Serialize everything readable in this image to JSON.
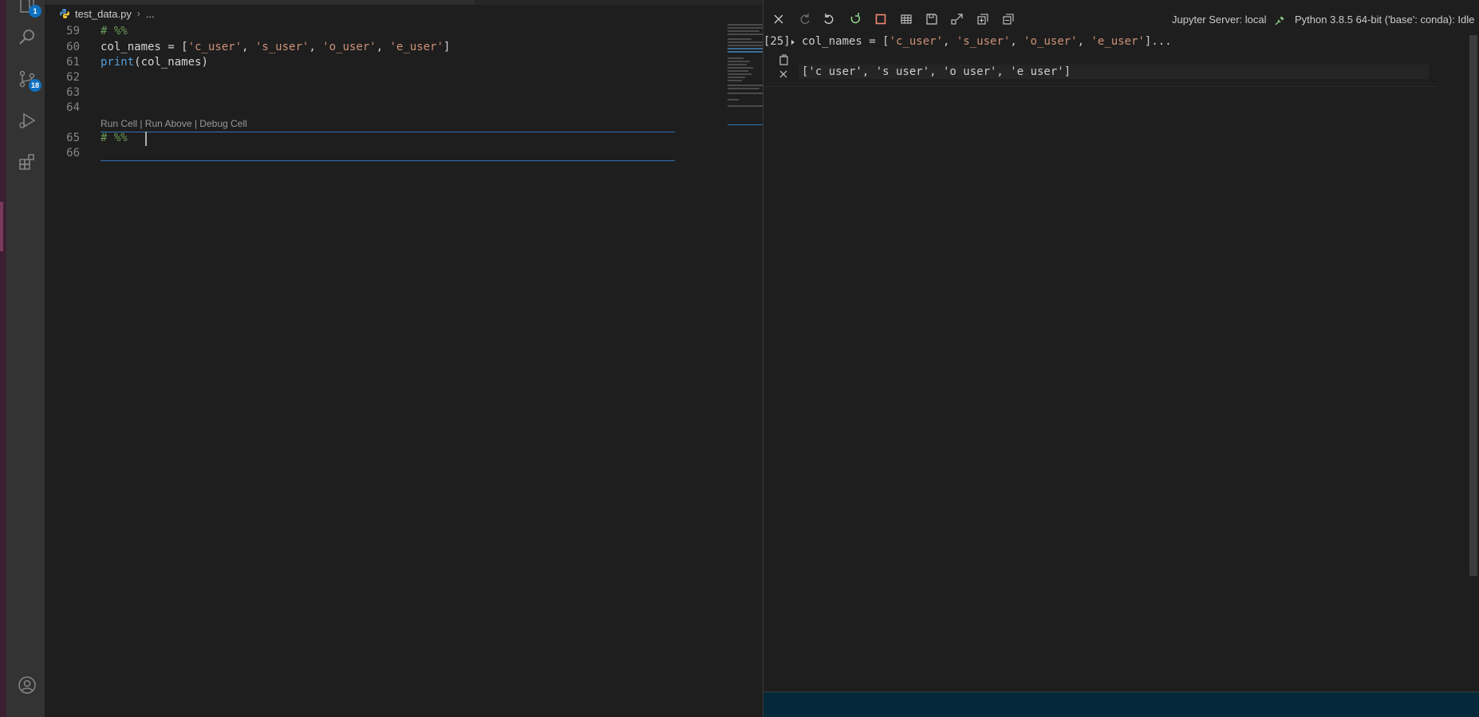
{
  "editor": {
    "breadcrumb": {
      "file": "test_data.py",
      "sep": "›",
      "more": "..."
    },
    "lines": [
      {
        "num": "59",
        "tokens": [
          {
            "t": "# %%",
            "c": "cmt"
          }
        ]
      },
      {
        "num": "60",
        "tokens": [
          {
            "t": "col_names = [",
            "c": ""
          },
          {
            "t": "'c_user'",
            "c": "str"
          },
          {
            "t": ", ",
            "c": ""
          },
          {
            "t": "'s_user'",
            "c": "str"
          },
          {
            "t": ", ",
            "c": ""
          },
          {
            "t": "'o_user'",
            "c": "str"
          },
          {
            "t": ", ",
            "c": ""
          },
          {
            "t": "'e_user'",
            "c": "str"
          },
          {
            "t": "]",
            "c": ""
          }
        ]
      },
      {
        "num": "61",
        "tokens": [
          {
            "t": "print",
            "c": "fn"
          },
          {
            "t": "(col_names)",
            "c": ""
          }
        ]
      },
      {
        "num": "62",
        "tokens": []
      },
      {
        "num": "63",
        "tokens": []
      },
      {
        "num": "64",
        "tokens": []
      },
      {
        "num": "65",
        "tokens": [
          {
            "t": "# %%",
            "c": "cmt"
          }
        ]
      },
      {
        "num": "66",
        "tokens": []
      }
    ],
    "codelens": "Run Cell | Run Above | Debug Cell"
  },
  "activity_bar": {
    "explorer_badge": "1",
    "scm_badge": "18"
  },
  "interactive": {
    "server_label": "Jupyter Server: local",
    "kernel_label": "Python 3.8.5 64-bit ('base': conda): Idle",
    "cell": {
      "count": "[25]",
      "source_prefix": "col_names = [",
      "source_tokens": [
        {
          "t": "'c_user'",
          "c": "str"
        },
        {
          "t": ", ",
          "c": ""
        },
        {
          "t": "'s_user'",
          "c": "str"
        },
        {
          "t": ", ",
          "c": ""
        },
        {
          "t": "'o_user'",
          "c": "str"
        },
        {
          "t": ", ",
          "c": ""
        },
        {
          "t": "'e_user'",
          "c": "str"
        },
        {
          "t": "]...",
          "c": ""
        }
      ],
      "output": "['c user', 's user', 'o user', 'e user']"
    }
  },
  "icons": {
    "activity_bar": [
      "explorer-icon",
      "search-icon",
      "source-control-icon",
      "run-debug-icon",
      "extensions-icon",
      "account-icon"
    ],
    "toolbar": [
      "clear-all-icon",
      "redo-icon",
      "undo-icon",
      "restart-kernel-icon",
      "interrupt-kernel-icon",
      "variables-icon",
      "save-icon",
      "export-icon",
      "expand-all-icon",
      "collapse-all-icon"
    ]
  },
  "colors": {
    "accent": "#0e70c0",
    "cell_border": "#2d74b8",
    "string": "#ce9178",
    "comment": "#6a9955",
    "keyword": "#569cd6",
    "restart_green": "#89d185",
    "interrupt_red": "#f48771"
  }
}
